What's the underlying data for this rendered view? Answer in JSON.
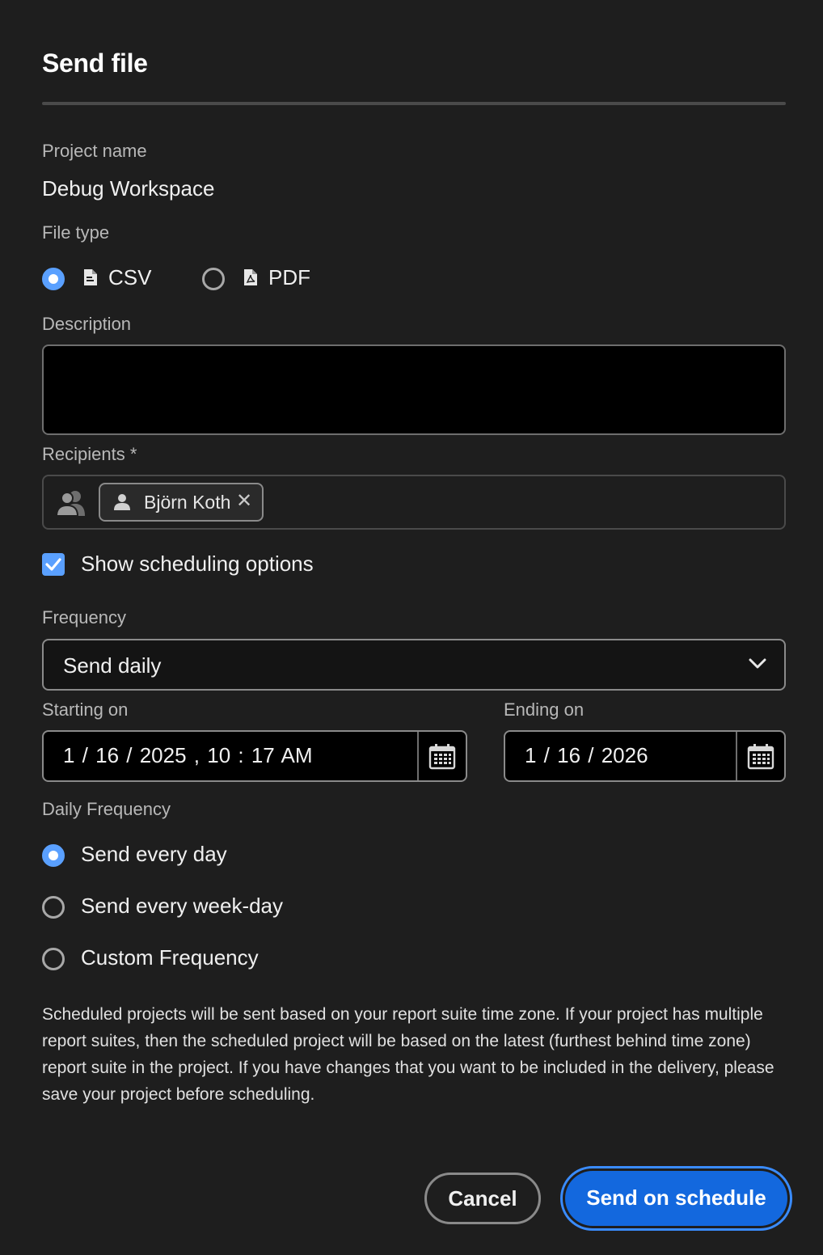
{
  "dialog": {
    "title": "Send file"
  },
  "project": {
    "label": "Project name",
    "value": "Debug Workspace"
  },
  "file_type": {
    "label": "File type",
    "options": [
      {
        "label": "CSV",
        "selected": true,
        "icon": "file-csv-icon"
      },
      {
        "label": "PDF",
        "selected": false,
        "icon": "file-pdf-icon"
      }
    ]
  },
  "description": {
    "label": "Description",
    "value": ""
  },
  "recipients": {
    "label": "Recipients",
    "required_marker": "*",
    "tags": [
      {
        "name": "Björn Koth",
        "remove_glyph": "✕"
      }
    ]
  },
  "scheduling": {
    "checkbox_label": "Show scheduling options",
    "checked": true
  },
  "frequency": {
    "label": "Frequency",
    "selected": "Send daily"
  },
  "starting_on": {
    "label": "Starting on",
    "value": "1 / 16 / 2025 ,  10 : 17  AM"
  },
  "ending_on": {
    "label": "Ending on",
    "value": "1 / 16 / 2026"
  },
  "daily_frequency": {
    "label": "Daily Frequency",
    "options": [
      {
        "label": "Send every day",
        "selected": true
      },
      {
        "label": "Send every week-day",
        "selected": false
      },
      {
        "label": "Custom Frequency",
        "selected": false
      }
    ]
  },
  "info_text": "Scheduled projects will be sent based on your report suite time zone. If your project has multiple report suites, then the scheduled project will be based on the latest (furthest behind time zone) report suite in the project. If you have changes that you want to be included in the delivery, please save your project before scheduling.",
  "actions": {
    "cancel": "Cancel",
    "primary": "Send on schedule"
  },
  "colors": {
    "background": "#1e1e1e",
    "accent": "#5aa0ff",
    "primary_button": "#1368de"
  }
}
